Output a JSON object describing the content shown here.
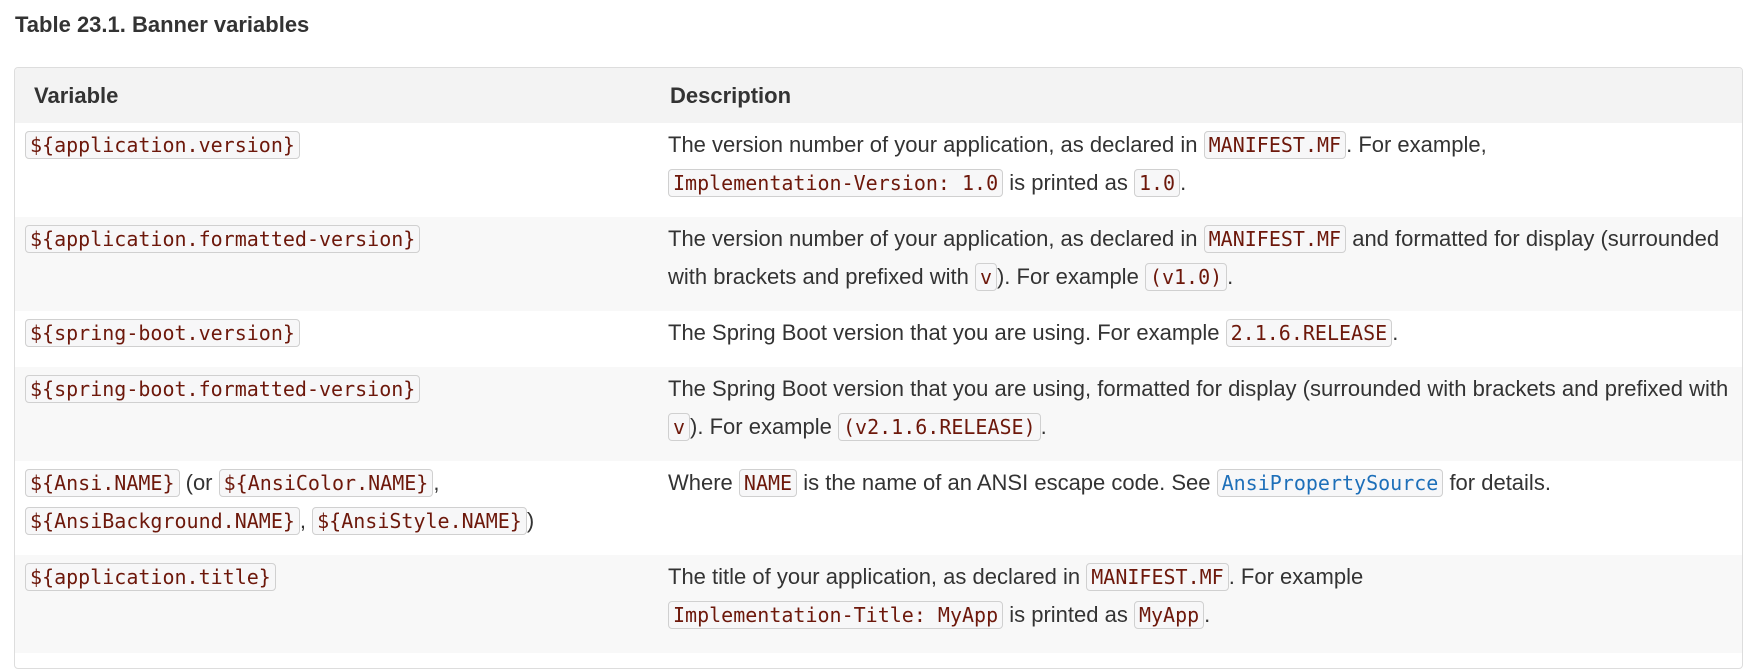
{
  "caption": "Table 23.1. Banner variables",
  "headers": {
    "variable": "Variable",
    "description": "Description"
  },
  "rows": [
    {
      "var": "${application.version}",
      "d": [
        "The version number of your application, as declared in ",
        "MANIFEST.MF",
        ". For example, ",
        "Implementation-Version: 1.0",
        " is printed as ",
        "1.0",
        "."
      ]
    },
    {
      "var": "${application.formatted-version}",
      "d": [
        "The version number of your application, as declared in ",
        "MANIFEST.MF",
        " and formatted for display (surrounded with brackets and prefixed with ",
        "v",
        "). For example ",
        "(v1.0)",
        "."
      ]
    },
    {
      "var": "${spring-boot.version}",
      "d": [
        "The Spring Boot version that you are using. For example ",
        "2.1.6.RELEASE",
        "."
      ]
    },
    {
      "var": "${spring-boot.formatted-version}",
      "d": [
        "The Spring Boot version that you are using, formatted for display (surrounded with brackets and prefixed with ",
        "v",
        "). For example ",
        "(v2.1.6.RELEASE)",
        "."
      ]
    },
    {
      "v": [
        "${Ansi.NAME}",
        " (or ",
        "${AnsiColor.NAME}",
        ", ",
        "${AnsiBackground.NAME}",
        ", ",
        "${AnsiStyle.NAME}",
        ")"
      ],
      "d": [
        "Where ",
        "NAME",
        " is the name of an ANSI escape code. See ",
        "AnsiPropertySource",
        " for details."
      ]
    },
    {
      "var": "${application.title}",
      "d": [
        "The title of your application, as declared in ",
        "MANIFEST.MF",
        ". For example ",
        "Implementation-Title: MyApp",
        " is printed as ",
        "MyApp",
        "."
      ]
    }
  ]
}
